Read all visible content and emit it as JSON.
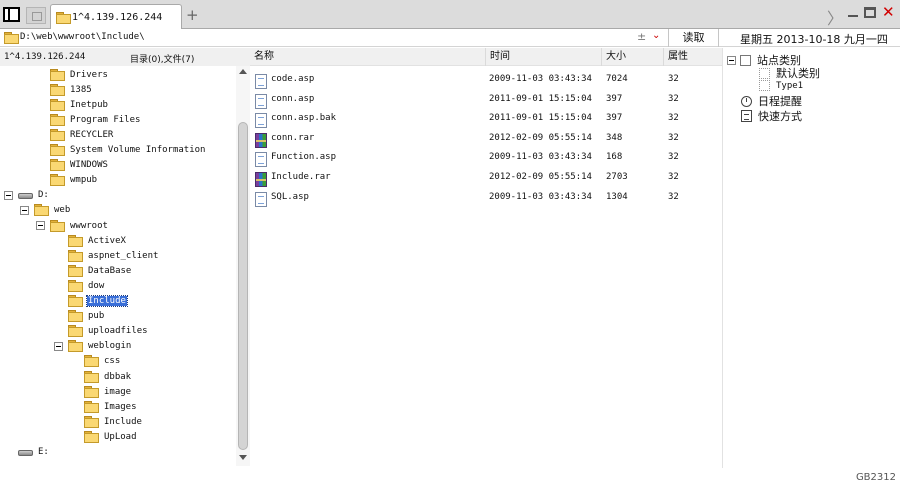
{
  "tabbar": {
    "tab_title": "1^4.139.126.244",
    "add_tab": "+",
    "nav_more": "〉",
    "close_glyph": "✕"
  },
  "addressbar": {
    "path": "D:\\web\\wwwroot\\Include\\",
    "plus_minus": "±",
    "chevron": "⌄",
    "read_label": "读取",
    "datetime": "星期五  2013-10-18  九月一四"
  },
  "left": {
    "ip_label": "1^4.139.126.244",
    "counts_label": "目录(0),文件(7)",
    "tree": [
      {
        "label": "Drivers",
        "type": "folder",
        "level": 2
      },
      {
        "label": "1385",
        "type": "folder",
        "level": 2
      },
      {
        "label": "Inetpub",
        "type": "folder",
        "level": 2
      },
      {
        "label": "Program Files",
        "type": "folder",
        "level": 2
      },
      {
        "label": "RECYCLER",
        "type": "folder",
        "level": 2
      },
      {
        "label": "System Volume Information",
        "type": "folder",
        "level": 2
      },
      {
        "label": "WINDOWS",
        "type": "folder",
        "level": 2
      },
      {
        "label": "wmpub",
        "type": "folder",
        "level": 2
      },
      {
        "label": "D:",
        "type": "drive",
        "level": 0,
        "expanded": true
      },
      {
        "label": "web",
        "type": "folder",
        "level": 1,
        "expanded": true
      },
      {
        "label": "wwwroot",
        "type": "folder",
        "level": 2,
        "expanded": true
      },
      {
        "label": "ActiveX",
        "type": "folder",
        "level": 3
      },
      {
        "label": "aspnet_client",
        "type": "folder",
        "level": 3
      },
      {
        "label": "DataBase",
        "type": "folder",
        "level": 3
      },
      {
        "label": "dow",
        "type": "folder",
        "level": 3
      },
      {
        "label": "Include",
        "type": "folder",
        "level": 3,
        "selected": true
      },
      {
        "label": "pub",
        "type": "folder",
        "level": 3
      },
      {
        "label": "uploadfiles",
        "type": "folder",
        "level": 3
      },
      {
        "label": "weblogin",
        "type": "folder",
        "level": 3,
        "expanded": true
      },
      {
        "label": "css",
        "type": "folder",
        "level": 4
      },
      {
        "label": "dbbak",
        "type": "folder",
        "level": 4
      },
      {
        "label": "image",
        "type": "folder",
        "level": 4
      },
      {
        "label": "Images",
        "type": "folder",
        "level": 4
      },
      {
        "label": "Include",
        "type": "folder",
        "level": 4
      },
      {
        "label": "UpLoad",
        "type": "folder",
        "level": 4
      },
      {
        "label": "E:",
        "type": "drive",
        "level": 0
      }
    ]
  },
  "list": {
    "columns": {
      "name": "名称",
      "time": "时间",
      "size": "大小",
      "attr": "属性"
    },
    "files": [
      {
        "name": "code.asp",
        "time": "2009-11-03 03:43:34",
        "size": "7024",
        "attr": "32",
        "icon": "doc"
      },
      {
        "name": "conn.asp",
        "time": "2011-09-01 15:15:04",
        "size": "397",
        "attr": "32",
        "icon": "doc"
      },
      {
        "name": "conn.asp.bak",
        "time": "2011-09-01 15:15:04",
        "size": "397",
        "attr": "32",
        "icon": "doc"
      },
      {
        "name": "conn.rar",
        "time": "2012-02-09 05:55:14",
        "size": "348",
        "attr": "32",
        "icon": "rar"
      },
      {
        "name": "Function.asp",
        "time": "2009-11-03 03:43:34",
        "size": "168",
        "attr": "32",
        "icon": "doc"
      },
      {
        "name": "Include.rar",
        "time": "2012-02-09 05:55:14",
        "size": "2703",
        "attr": "32",
        "icon": "rar"
      },
      {
        "name": "SQL.asp",
        "time": "2009-11-03 03:43:34",
        "size": "1304",
        "attr": "32",
        "icon": "doc"
      }
    ]
  },
  "right": {
    "site_category": "站点类别",
    "default_category": "默认类别",
    "type1": "Type1",
    "daily_reminder": "日程提醒",
    "shortcut": "快速方式"
  },
  "status": {
    "code": "GB2312"
  },
  "colors": {
    "accent": "#3a6fd8",
    "close": "#d10000",
    "folder": "#fad873"
  }
}
